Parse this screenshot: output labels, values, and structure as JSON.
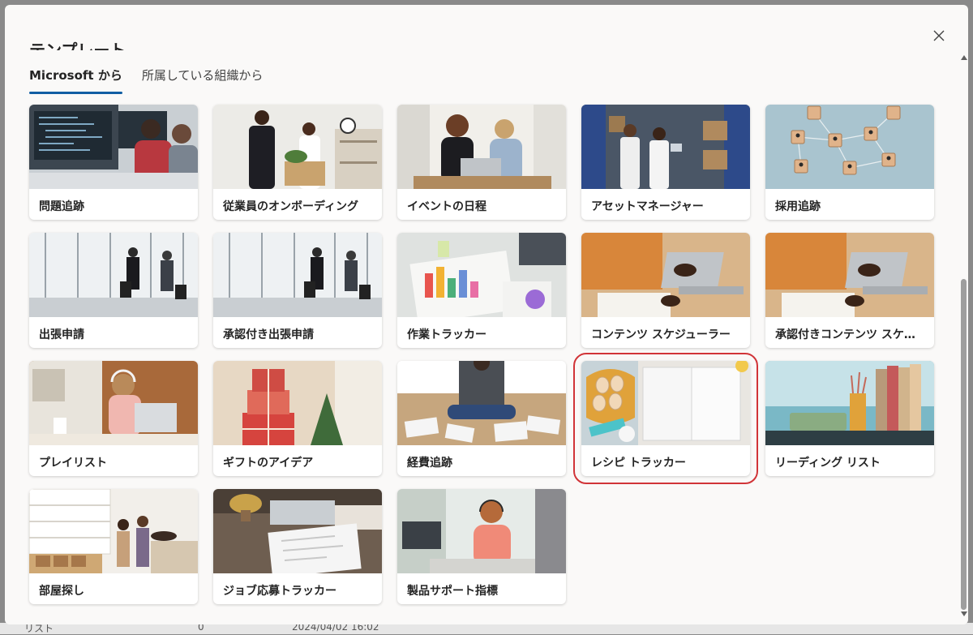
{
  "dialog": {
    "title": "テンプレート",
    "tabs": [
      {
        "label": "Microsoft から",
        "active": true
      },
      {
        "label": "所属している組織から",
        "active": false
      }
    ]
  },
  "templates": [
    {
      "label": "問題追跡",
      "icon": "coding-office-image"
    },
    {
      "label": "従業員のオンボーディング",
      "icon": "onboarding-box-image"
    },
    {
      "label": "イベントの日程",
      "icon": "meeting-laptop-image"
    },
    {
      "label": "アセットマネージャー",
      "icon": "warehouse-image"
    },
    {
      "label": "採用追跡",
      "icon": "network-blocks-image"
    },
    {
      "label": "出張申請",
      "icon": "airport-travelers-image"
    },
    {
      "label": "承認付き出張申請",
      "icon": "airport-travelers-image"
    },
    {
      "label": "作業トラッカー",
      "icon": "planning-charts-image"
    },
    {
      "label": "コンテンツ スケジューラー",
      "icon": "laptop-desk-image"
    },
    {
      "label": "承認付きコンテンツ スケジューラー",
      "icon": "laptop-desk-image"
    },
    {
      "label": "プレイリスト",
      "icon": "headphones-laptop-image"
    },
    {
      "label": "ギフトのアイデア",
      "icon": "gift-boxes-image"
    },
    {
      "label": "経費追跡",
      "icon": "receipts-floor-image"
    },
    {
      "label": "レシピ トラッカー",
      "icon": "recipe-notebook-image",
      "selected": true
    },
    {
      "label": "リーディング リスト",
      "icon": "books-shelf-image"
    },
    {
      "label": "部屋探し",
      "icon": "room-entrance-image"
    },
    {
      "label": "ジョブ応募トラッカー",
      "icon": "job-application-image"
    },
    {
      "label": "製品サポート指標",
      "icon": "support-headset-image"
    }
  ],
  "backdrop": {
    "row_name": "リスト",
    "row_count": "0",
    "row_date": "2024/04/02 16:02"
  }
}
